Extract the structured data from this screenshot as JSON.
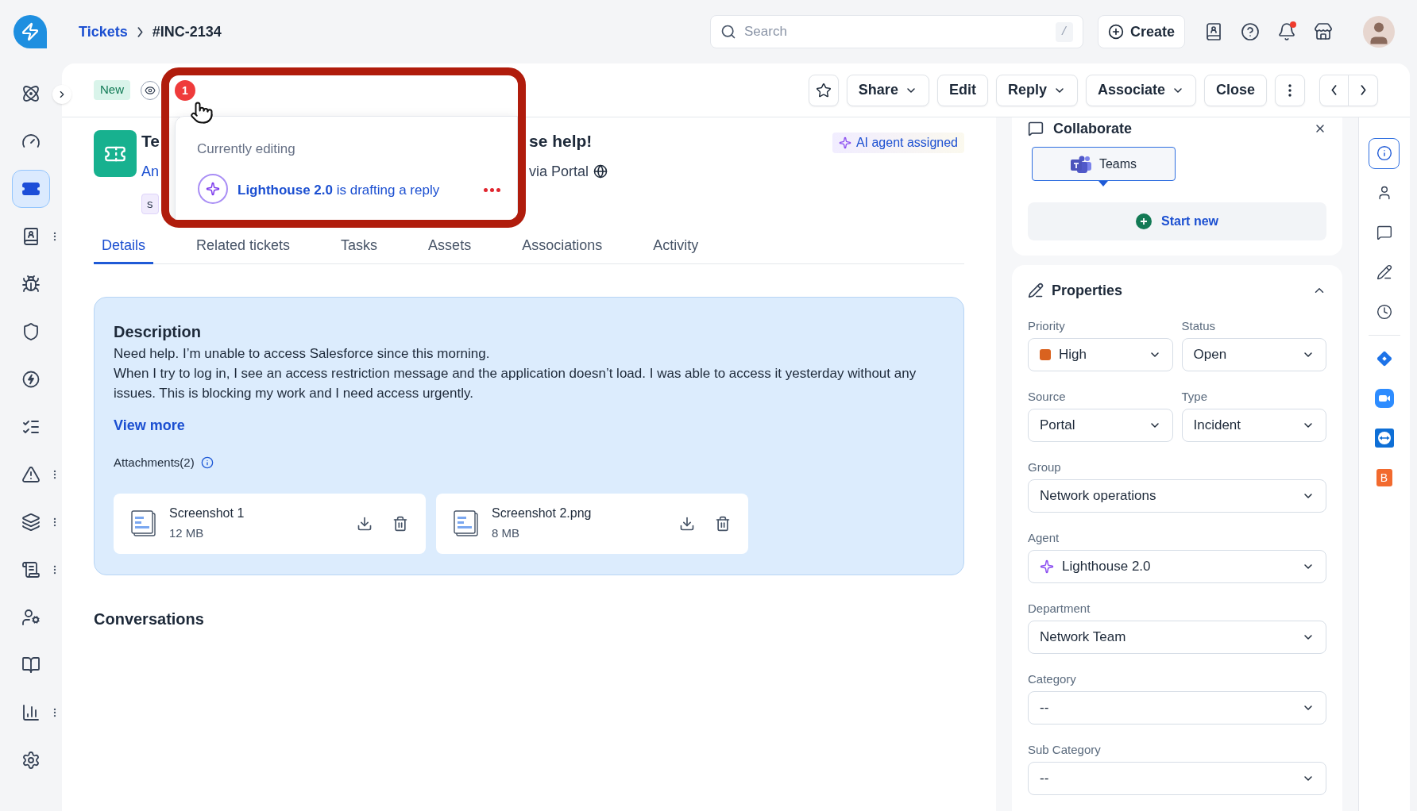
{
  "topbar": {
    "breadcrumb": [
      {
        "label": "Tickets",
        "kind": "link"
      },
      {
        "label": "#INC-2134",
        "kind": "current"
      }
    ],
    "search": {
      "placeholder": "Search",
      "shortcut": "/"
    },
    "create_button": "Create",
    "notifications": {
      "unread": true
    }
  },
  "sidebar": {
    "items": [
      {
        "selected": false,
        "has_menu": false
      },
      {
        "selected": false,
        "has_menu": false
      },
      {
        "selected": true,
        "has_menu": false
      },
      {
        "selected": false,
        "has_menu": true
      },
      {
        "selected": false,
        "has_menu": false
      },
      {
        "selected": false,
        "has_menu": false
      },
      {
        "selected": false,
        "has_menu": false
      },
      {
        "selected": false,
        "has_menu": false
      },
      {
        "selected": false,
        "has_menu": true
      },
      {
        "selected": false,
        "has_menu": true
      },
      {
        "selected": false,
        "has_menu": true
      },
      {
        "selected": false,
        "has_menu": false
      },
      {
        "selected": false,
        "has_menu": false
      },
      {
        "selected": false,
        "has_menu": true
      },
      {
        "selected": false,
        "has_menu": false
      }
    ]
  },
  "toolbar": {
    "status_badge": "New",
    "viewers_count": "1",
    "buttons": [
      {
        "label": "Share",
        "kind": "dropdown"
      },
      {
        "label": "Edit",
        "kind": "plain"
      },
      {
        "label": "Reply",
        "kind": "dropdown"
      },
      {
        "label": "Associate",
        "kind": "dropdown"
      },
      {
        "label": "Close",
        "kind": "plain"
      }
    ]
  },
  "presence_popup": {
    "heading": "Currently editing",
    "agent": "Lighthouse 2.0",
    "action": "is drafting a reply"
  },
  "ticket": {
    "title_start": "Te",
    "title_end": "se help!",
    "requester_start": "An",
    "source": "via Portal",
    "tag": "s",
    "ai_badge": "AI agent assigned"
  },
  "tabs": [
    {
      "label": "Details",
      "selected": true
    },
    {
      "label": "Related tickets",
      "selected": false
    },
    {
      "label": "Tasks",
      "selected": false
    },
    {
      "label": "Assets",
      "selected": false
    },
    {
      "label": "Associations",
      "selected": false
    },
    {
      "label": "Activity",
      "selected": false
    }
  ],
  "description": {
    "heading": "Description",
    "paragraphs": [
      "Need help. I’m unable to access Salesforce since this morning.",
      "When I try to log in, I see an access restriction message and the application doesn’t load. I was able to access it yesterday without any issues. This is blocking my work and I need access urgently."
    ],
    "view_more": "View more",
    "attachments_label": "Attachments(2)",
    "attachments": [
      {
        "name": "Screenshot 1",
        "size": "12 MB"
      },
      {
        "name": "Screenshot 2.png",
        "size": "8 MB"
      }
    ]
  },
  "conversations": {
    "heading": "Conversations"
  },
  "collaborate": {
    "title": "Collaborate",
    "apps": [
      {
        "label": "Teams",
        "selected": true
      }
    ],
    "start_new": "Start new"
  },
  "properties": {
    "title": "Properties",
    "expanded": true,
    "rows": [
      [
        {
          "label": "Priority",
          "value": "High",
          "kind": "color",
          "color": "#d9621f"
        },
        {
          "label": "Status",
          "value": "Open",
          "kind": "plain"
        }
      ],
      [
        {
          "label": "Source",
          "value": "Portal",
          "kind": "plain"
        },
        {
          "label": "Type",
          "value": "Incident",
          "kind": "plain"
        }
      ],
      [
        {
          "label": "Group",
          "value": "Network operations",
          "kind": "plain"
        }
      ],
      [
        {
          "label": "Agent",
          "value": "Lighthouse 2.0",
          "kind": "ai"
        }
      ],
      [
        {
          "label": "Department",
          "value": "Network Team",
          "kind": "plain"
        }
      ],
      [
        {
          "label": "Category",
          "value": "--",
          "kind": "plain"
        }
      ],
      [
        {
          "label": "Sub Category",
          "value": "--",
          "kind": "plain"
        }
      ]
    ]
  },
  "rail": {
    "items": [
      {
        "selected": true
      },
      {
        "selected": false
      },
      {
        "selected": false
      },
      {
        "selected": false
      },
      {
        "selected": false
      },
      {
        "selected": false
      },
      {
        "selected": false
      },
      {
        "selected": false
      },
      {
        "selected": false,
        "label": "B"
      }
    ]
  }
}
